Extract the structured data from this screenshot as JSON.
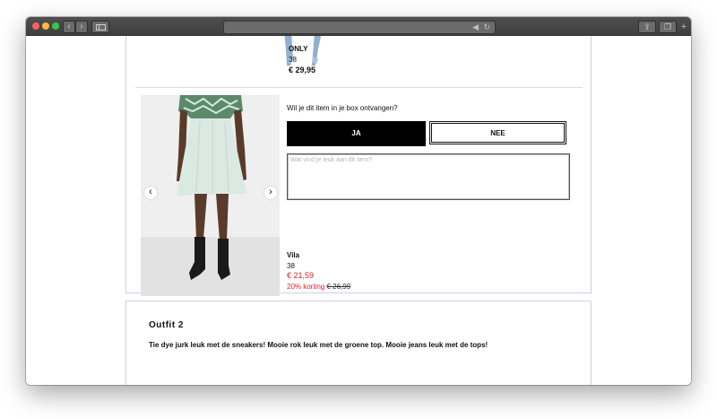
{
  "browser": {
    "url": "",
    "icons": [
      "back-icon",
      "forward-icon",
      "sidebar-icon",
      "lock-icon",
      "audio-icon",
      "reload-icon",
      "share-icon",
      "tabs-icon",
      "new-tab-icon"
    ]
  },
  "item_above": {
    "brand": "ONLY",
    "size": "38",
    "price": "€ 29,95"
  },
  "item": {
    "question": "Wil je dit item in je box ontvangen?",
    "yes_label": "JA",
    "no_label": "NEE",
    "comment_placeholder": "Wat vind je leuk aan dit item?",
    "brand": "Vila",
    "size": "38",
    "price": "€ 21,59",
    "discount_label": "20% korting",
    "old_price": "€ 26,99"
  },
  "outfit2": {
    "title": "Outfit 2",
    "description": "Tie dye jurk leuk met de sneakers! Mooie rok leuk met de groene top. Mooie jeans leuk met de tops!"
  },
  "colors": {
    "accent": "#000000",
    "sale": "#e02020",
    "panel_border": "#cfcfe6"
  }
}
